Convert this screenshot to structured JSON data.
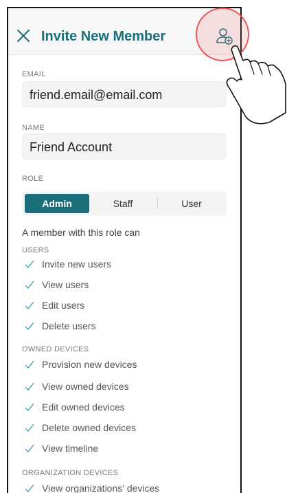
{
  "header": {
    "title": "Invite New Member",
    "close_icon": "close-icon",
    "add_icon": "add-user-icon"
  },
  "form": {
    "email_label": "EMAIL",
    "email_value": "friend.email@email.com",
    "name_label": "NAME",
    "name_value": "Friend Account",
    "role_label": "ROLE",
    "roles": [
      "Admin",
      "Staff",
      "User"
    ],
    "selected_role": "Admin"
  },
  "permissions": {
    "intro": "A member with this role can",
    "sections": [
      {
        "label": "USERS",
        "items": [
          "Invite new users",
          "View users",
          "Edit users",
          "Delete users"
        ]
      },
      {
        "label": "OWNED DEVICES",
        "items": [
          "Provision new devices",
          "View owned devices",
          "Edit owned devices",
          "Delete owned devices",
          "View timeline"
        ]
      },
      {
        "label": "ORGANIZATION DEVICES",
        "items": [
          "View organizations' devices"
        ]
      }
    ]
  },
  "colors": {
    "accent": "#1b6e7b",
    "check": "#2f9aa3",
    "tap_ring": "#e75757"
  }
}
